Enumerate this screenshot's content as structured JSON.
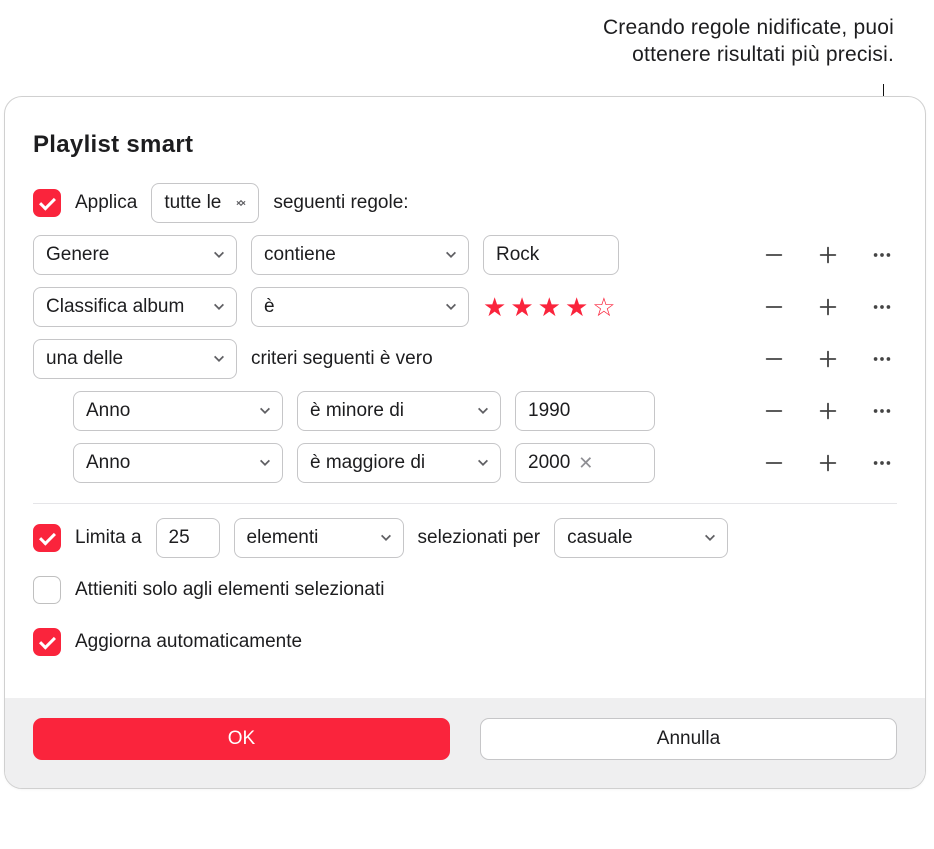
{
  "callout": {
    "line1": "Creando regole nidificate, puoi",
    "line2": "ottenere risultati più precisi."
  },
  "window": {
    "title": "Playlist smart"
  },
  "match": {
    "apply_label": "Applica",
    "mode": "tutte le",
    "suffix": "seguenti regole:"
  },
  "rules": [
    {
      "field": "Genere",
      "op": "contiene",
      "value": "Rock"
    },
    {
      "field": "Classifica album",
      "op": "è",
      "stars": 4
    },
    {
      "group_mode": "una delle",
      "suffix": "criteri seguenti è vero",
      "children": [
        {
          "field": "Anno",
          "op": "è minore di",
          "value": "1990"
        },
        {
          "field": "Anno",
          "op": "è maggiore di",
          "value": "2000",
          "clearable": true
        }
      ]
    }
  ],
  "limit": {
    "label": "Limita a",
    "count": "25",
    "unit": "elementi",
    "selected_by_label": "selezionati per",
    "order": "casuale"
  },
  "checked_only": {
    "label": "Attieniti solo agli elementi selezionati"
  },
  "live": {
    "label": "Aggiorna automaticamente"
  },
  "buttons": {
    "ok": "OK",
    "cancel": "Annulla"
  }
}
